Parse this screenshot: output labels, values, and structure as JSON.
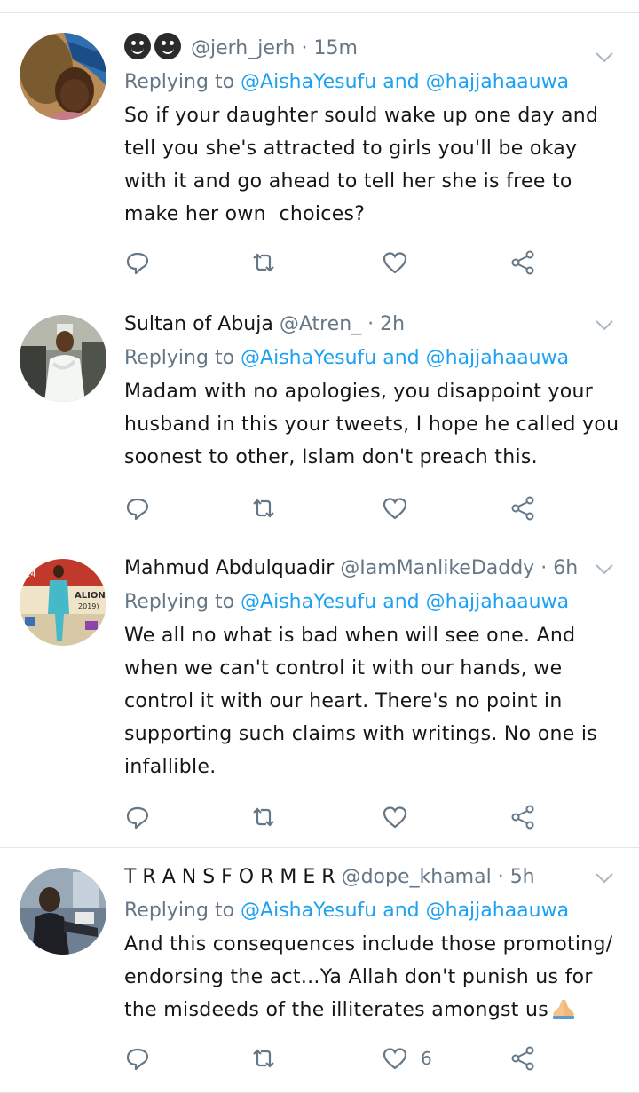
{
  "tweets": [
    {
      "name": "",
      "name_emojis": [
        "smiling-face",
        "smiling-face"
      ],
      "handle": "@jerh_jerh",
      "time": "15m",
      "reply_prefix": "Replying to",
      "reply_mention1": "@AishaYesufu",
      "reply_and": "and",
      "reply_mention2": "@hajjahaauwa",
      "lines": [
        "So if your daughter sould wake up one day and",
        "tell you she's attracted to girls you'll be okay",
        "with it and go ahead to tell her she is free to",
        "make her own  choices?"
      ],
      "like_count": ""
    },
    {
      "name": "Sultan of Abuja",
      "handle": "@Atren_",
      "time": "2h",
      "reply_prefix": "Replying to",
      "reply_mention1": "@AishaYesufu",
      "reply_and": "and",
      "reply_mention2": "@hajjahaauwa",
      "lines": [
        "Madam with no apologies, you disappoint your",
        "husband in this your tweets, I hope he called you",
        "soonest to other, Islam don't preach this."
      ],
      "like_count": ""
    },
    {
      "name": "Mahmud Abdulquadir",
      "handle": "@IamManlikeDaddy",
      "time": "6h",
      "reply_prefix": "Replying to",
      "reply_mention1": "@AishaYesufu",
      "reply_and": "and",
      "reply_mention2": "@hajjahaauwa",
      "lines": [
        "We all no what is bad when will see one. And",
        "when we can't control it with our hands, we",
        "control it with our heart. There's no point in",
        "supporting such claims with writings. No one is",
        "infallible."
      ],
      "like_count": "",
      "avatar_text": [
        "14",
        "ALION",
        "2019)"
      ]
    },
    {
      "name": "T R A N S F O R M E R",
      "handle": "@dope_khamal",
      "time": "5h",
      "reply_prefix": "Replying to",
      "reply_mention1": "@AishaYesufu",
      "reply_and": "and",
      "reply_mention2": "@hajjahaauwa",
      "lines": [
        "And this consequences include those promoting/",
        "endorsing the act...Ya Allah don't punish us for",
        "the misdeeds of the illiterates amongst us"
      ],
      "line_emoji": "folded-hands",
      "like_count": "6"
    }
  ],
  "icons": {
    "reply": "reply-icon",
    "retweet": "retweet-icon",
    "like": "heart-icon",
    "share": "share-icon",
    "menu": "chevron-down-icon"
  },
  "colors": {
    "mention": "#1da1f2",
    "secondary": "#657786",
    "divider": "#e1e8ed"
  },
  "sep": "·"
}
